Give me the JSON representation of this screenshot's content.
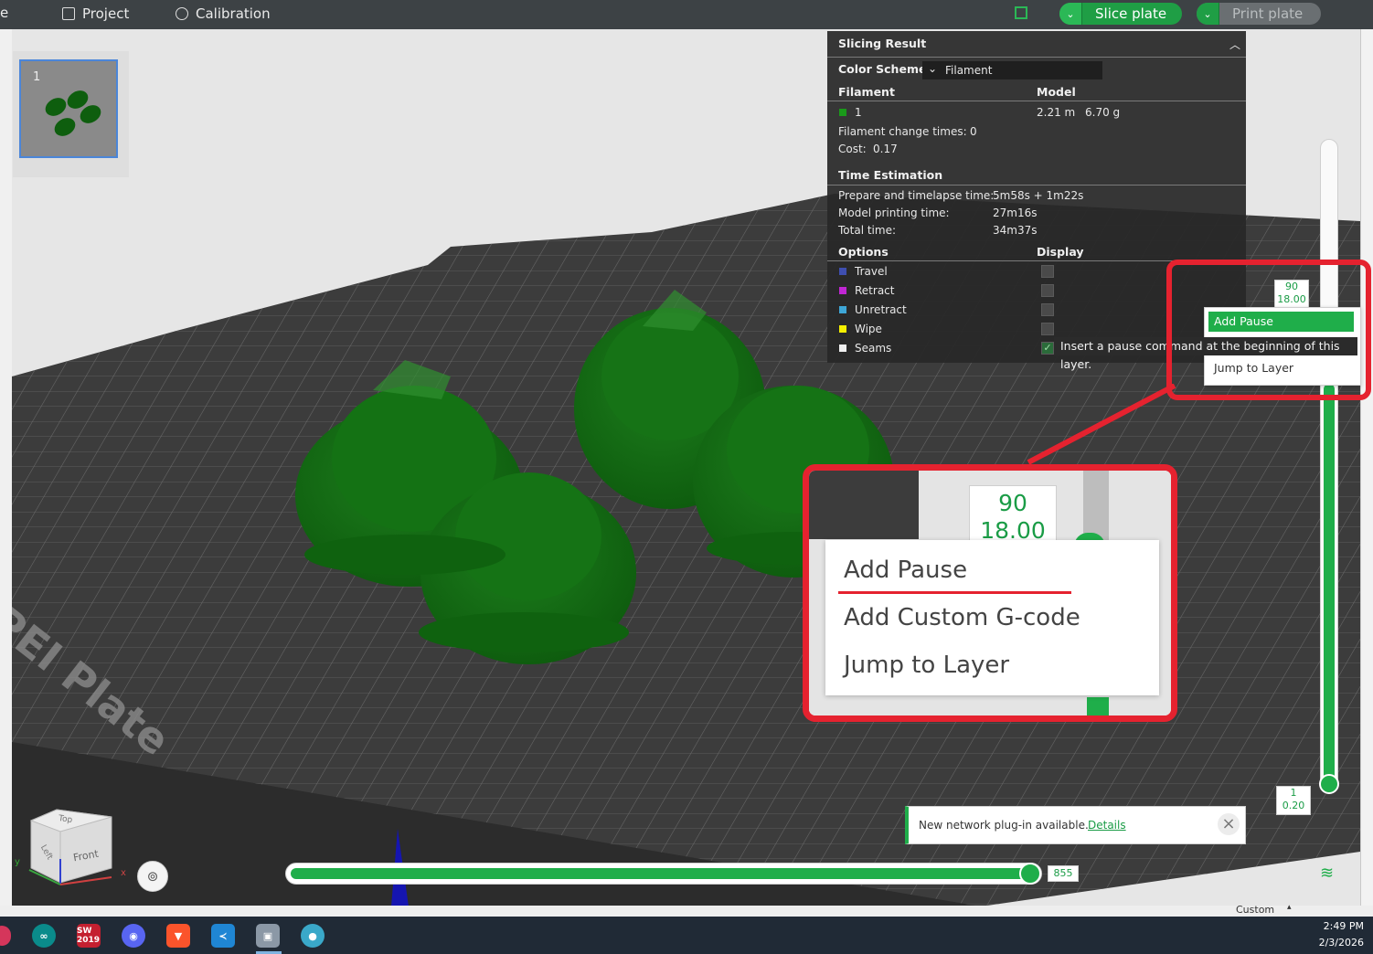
{
  "topbar": {
    "project_label": "Project",
    "calibration_label": "Calibration",
    "slice_label": "Slice plate",
    "print_label": "Print plate",
    "edge_letter": "e"
  },
  "left": {
    "collapse_icon": "‹|›",
    "plate_number": "1"
  },
  "viewport": {
    "plate_text": "PEI Plate"
  },
  "slicing": {
    "title": "Slicing Result",
    "color_scheme_label": "Color Scheme",
    "color_scheme_value": "Filament",
    "filament_header": "Filament",
    "model_header": "Model",
    "filament_id": "1",
    "filament_color": "#1a7a1a",
    "length": "2.21 m",
    "weight": "6.70 g",
    "change_times_label": "Filament change times:",
    "change_times_value": "0",
    "cost_label": "Cost:",
    "cost_value": "0.17",
    "time_header": "Time Estimation",
    "prepare_label": "Prepare and timelapse time:",
    "prepare_value": "5m58s + 1m22s",
    "model_time_label": "Model printing time:",
    "model_time_value": "27m16s",
    "total_label": "Total time:",
    "total_value": "34m37s",
    "options_header": "Options",
    "display_header": "Display",
    "options": [
      {
        "label": "Travel",
        "color": "#3f4fb0"
      },
      {
        "label": "Retract",
        "color": "#c026d3"
      },
      {
        "label": "Unretract",
        "color": "#3ea6d6"
      },
      {
        "label": "Wipe",
        "color": "#f5f000"
      },
      {
        "label": "Seams",
        "color": "#f0f0f0"
      }
    ]
  },
  "layer_slider": {
    "top_layer": "90",
    "top_height": "18.00",
    "bottom_layer": "1",
    "bottom_height": "0.20",
    "move_value": "855"
  },
  "context_menu": {
    "add_pause": "Add Pause",
    "jump_to_layer": "Jump to Layer",
    "tooltip": "Insert a pause command at the beginning of this layer."
  },
  "zoom_callout": {
    "layer": "90",
    "height": "18.00",
    "item1": "Add Pause",
    "item2": "Add Custom G-code",
    "item3": "Jump to Layer"
  },
  "notification": {
    "text": "New network plug-in available.",
    "link": "Details"
  },
  "nav_cube": {
    "top": "Top",
    "left": "Left",
    "front": "Front",
    "axis_x": "x",
    "axis_y": "y"
  },
  "statusbar": {
    "custom_label": "Custom"
  },
  "taskbar": {
    "time": "2:49 PM",
    "date": "2/3/2026",
    "sw_label": "SW 2019"
  },
  "accent": "#1fae4a",
  "highlight_red": "#e5222f"
}
